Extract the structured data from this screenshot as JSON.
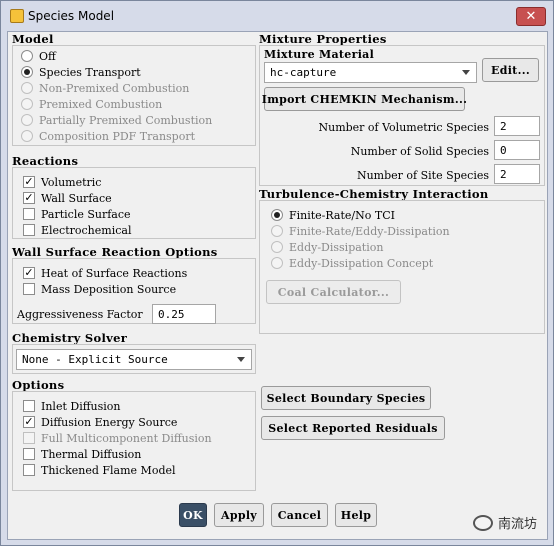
{
  "window": {
    "title": "Species Model",
    "close_glyph": "✕"
  },
  "model": {
    "heading": "Model",
    "options": [
      {
        "label": "Off",
        "selected": false,
        "enabled": true
      },
      {
        "label": "Species Transport",
        "selected": true,
        "enabled": true
      },
      {
        "label": "Non-Premixed Combustion",
        "selected": false,
        "enabled": false
      },
      {
        "label": "Premixed Combustion",
        "selected": false,
        "enabled": false
      },
      {
        "label": "Partially Premixed Combustion",
        "selected": false,
        "enabled": false
      },
      {
        "label": "Composition PDF Transport",
        "selected": false,
        "enabled": false
      }
    ]
  },
  "reactions": {
    "heading": "Reactions",
    "options": [
      {
        "label": "Volumetric",
        "checked": true,
        "enabled": true
      },
      {
        "label": "Wall Surface",
        "checked": true,
        "enabled": true
      },
      {
        "label": "Particle Surface",
        "checked": false,
        "enabled": true
      },
      {
        "label": "Electrochemical",
        "checked": false,
        "enabled": true
      }
    ]
  },
  "wall_surface": {
    "heading": "Wall Surface Reaction Options",
    "options": [
      {
        "label": "Heat of Surface Reactions",
        "checked": true,
        "enabled": true
      },
      {
        "label": "Mass Deposition Source",
        "checked": false,
        "enabled": true
      }
    ],
    "aggressiveness_label": "Aggressiveness Factor",
    "aggressiveness_value": "0.25"
  },
  "chemistry_solver": {
    "heading": "Chemistry Solver",
    "value": "None - Explicit Source"
  },
  "options": {
    "heading": "Options",
    "items": [
      {
        "label": "Inlet Diffusion",
        "checked": false,
        "enabled": true
      },
      {
        "label": "Diffusion Energy Source",
        "checked": true,
        "enabled": true
      },
      {
        "label": "Full Multicomponent Diffusion",
        "checked": false,
        "enabled": false
      },
      {
        "label": "Thermal Diffusion",
        "checked": false,
        "enabled": true
      },
      {
        "label": "Thickened Flame Model",
        "checked": false,
        "enabled": true
      }
    ]
  },
  "mixture": {
    "heading": "Mixture Properties",
    "material_label": "Mixture Material",
    "material_value": "hc-capture",
    "edit_label": "Edit...",
    "import_label": "Import CHEMKIN Mechanism...",
    "fields": [
      {
        "label": "Number of Volumetric Species",
        "value": "2"
      },
      {
        "label": "Number of Solid Species",
        "value": "0"
      },
      {
        "label": "Number of Site Species",
        "value": "2"
      }
    ]
  },
  "tci": {
    "heading": "Turbulence-Chemistry Interaction",
    "options": [
      {
        "label": "Finite-Rate/No TCI",
        "selected": true,
        "enabled": true
      },
      {
        "label": "Finite-Rate/Eddy-Dissipation",
        "selected": false,
        "enabled": false
      },
      {
        "label": "Eddy-Dissipation",
        "selected": false,
        "enabled": false
      },
      {
        "label": "Eddy-Dissipation Concept",
        "selected": false,
        "enabled": false
      }
    ],
    "coal_label": "Coal Calculator..."
  },
  "side_buttons": {
    "boundary_label": "Select Boundary Species",
    "residuals_label": "Select Reported Residuals"
  },
  "footer": {
    "ok_label": "OK",
    "apply_label": "Apply",
    "cancel_label": "Cancel",
    "help_label": "Help"
  },
  "watermark": {
    "text": "南流坊"
  }
}
